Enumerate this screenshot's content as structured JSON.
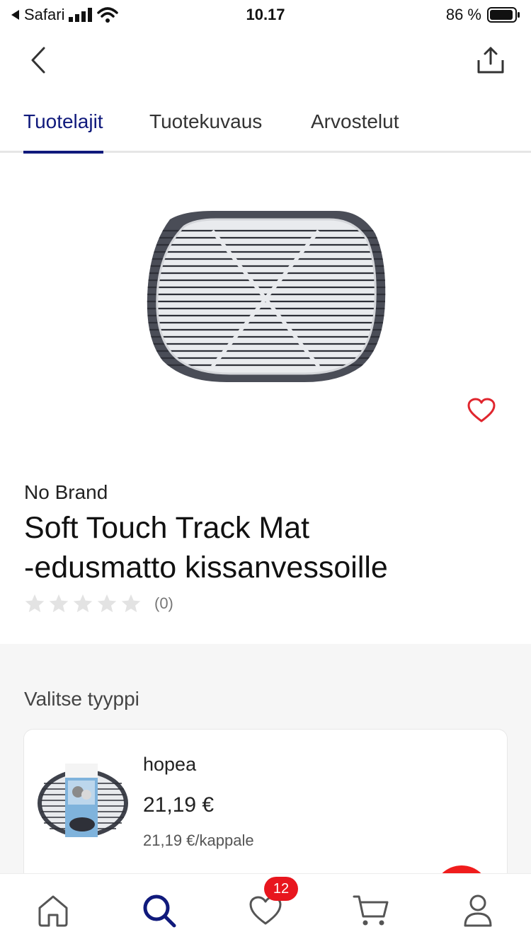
{
  "status_bar": {
    "back_app": "Safari",
    "time": "10.17",
    "battery": "86 %"
  },
  "nav": {
    "back_icon": "chevron-left-icon",
    "share_icon": "share-icon"
  },
  "tabs": [
    {
      "label": "Tuotelajit",
      "active": true
    },
    {
      "label": "Tuotekuvaus",
      "active": false
    },
    {
      "label": "Arvostelut",
      "active": false
    }
  ],
  "product": {
    "brand": "No Brand",
    "title_line1": "Soft Touch Track Mat",
    "title_line2": "-edusmatto kissanvessoille",
    "rating_stars": 0,
    "rating_count": "(0)"
  },
  "variants": {
    "section_title": "Valitse tyyppi",
    "items": [
      {
        "name": "hopea",
        "price": "21,19 €",
        "unit_price": "21,19 €/kappale"
      }
    ]
  },
  "bottom_nav": {
    "items": [
      "home-icon",
      "search-icon",
      "heart-icon",
      "cart-icon",
      "profile-icon"
    ],
    "favorites_badge": "12",
    "active": "search-icon"
  },
  "colors": {
    "accent": "#101a7c",
    "favorite_red": "#e8161e"
  }
}
